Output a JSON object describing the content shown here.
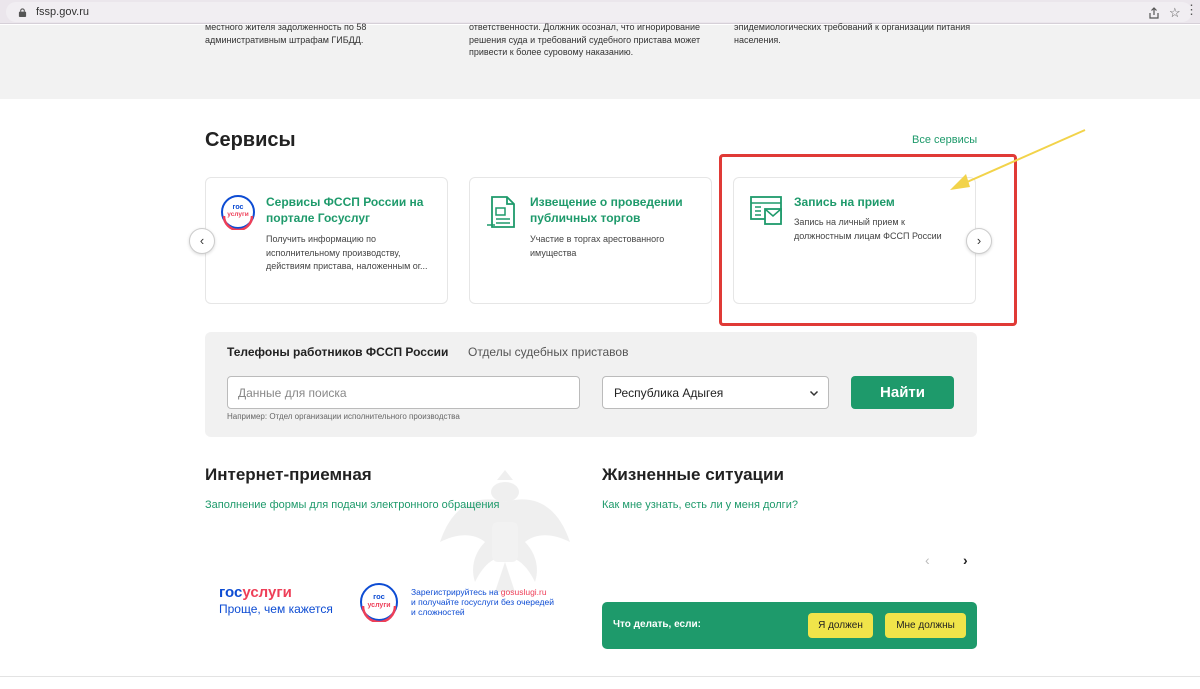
{
  "browser": {
    "url": "fssp.gov.ru"
  },
  "news": {
    "col1": [
      "местного жителя задолженность по 58",
      "административным штрафам ГИБДД."
    ],
    "col2": [
      "ответственности. Должник осознал, что игнорирование",
      "решения суда и требований судебного пристава может",
      "привести к более суровому наказанию."
    ],
    "col3": [
      "эпидемиологических требований к организации питания",
      "населения."
    ]
  },
  "services": {
    "title": "Сервисы",
    "all_link": "Все сервисы",
    "cards": [
      {
        "title": "Сервисы ФССП России на портале Госуслуг",
        "desc": "Получить информацию по исполнительному производству, действиям пристава, наложенным ог...",
        "icon": "gosuslugi-icon"
      },
      {
        "title": "Извещение о проведении публичных торгов",
        "desc": "Участие в торгах арестованного имущества",
        "icon": "document-icon"
      },
      {
        "title": "Запись на прием",
        "desc": "Запись на личный прием к должностным лицам ФССП России",
        "icon": "mail-calendar-icon"
      }
    ],
    "prev": "‹",
    "next": "›"
  },
  "search": {
    "tabs": [
      "Телефоны работников ФССП России",
      "Отделы судебных приставов"
    ],
    "placeholder": "Данные для поиска",
    "region": "Республика Адыгея",
    "button": "Найти",
    "hint": "Например: Отдел организации исполнительного производства"
  },
  "internet_reception": {
    "title": "Интернет-приемная",
    "link": "Заполнение формы для подачи электронного обращения"
  },
  "life_situations": {
    "title": "Жизненные ситуации",
    "link": "Как мне узнать, есть ли у меня долги?",
    "prev": "‹",
    "next": "›",
    "panel_label": "Что делать, если:",
    "buttons": [
      "Я должен",
      "Мне должны"
    ]
  },
  "gosuslugi": {
    "logo_gos": "гос",
    "logo_uslugi": "услуги",
    "slogan": "Проще, чем кажется",
    "badge_top": "гос",
    "badge_bottom": "услуги",
    "promo_line1": "Зарегистрируйтесь на ",
    "promo_link": "gosuslugi.ru",
    "promo_line2": "и получайте госуслуги без очередей",
    "promo_line3": "и сложностей"
  },
  "colors": {
    "accent": "#1e9a6b",
    "highlight": "#e03a36",
    "arrow": "#f2d34a",
    "gos_blue": "#0d4cd3",
    "gos_red": "#ee3f58"
  }
}
